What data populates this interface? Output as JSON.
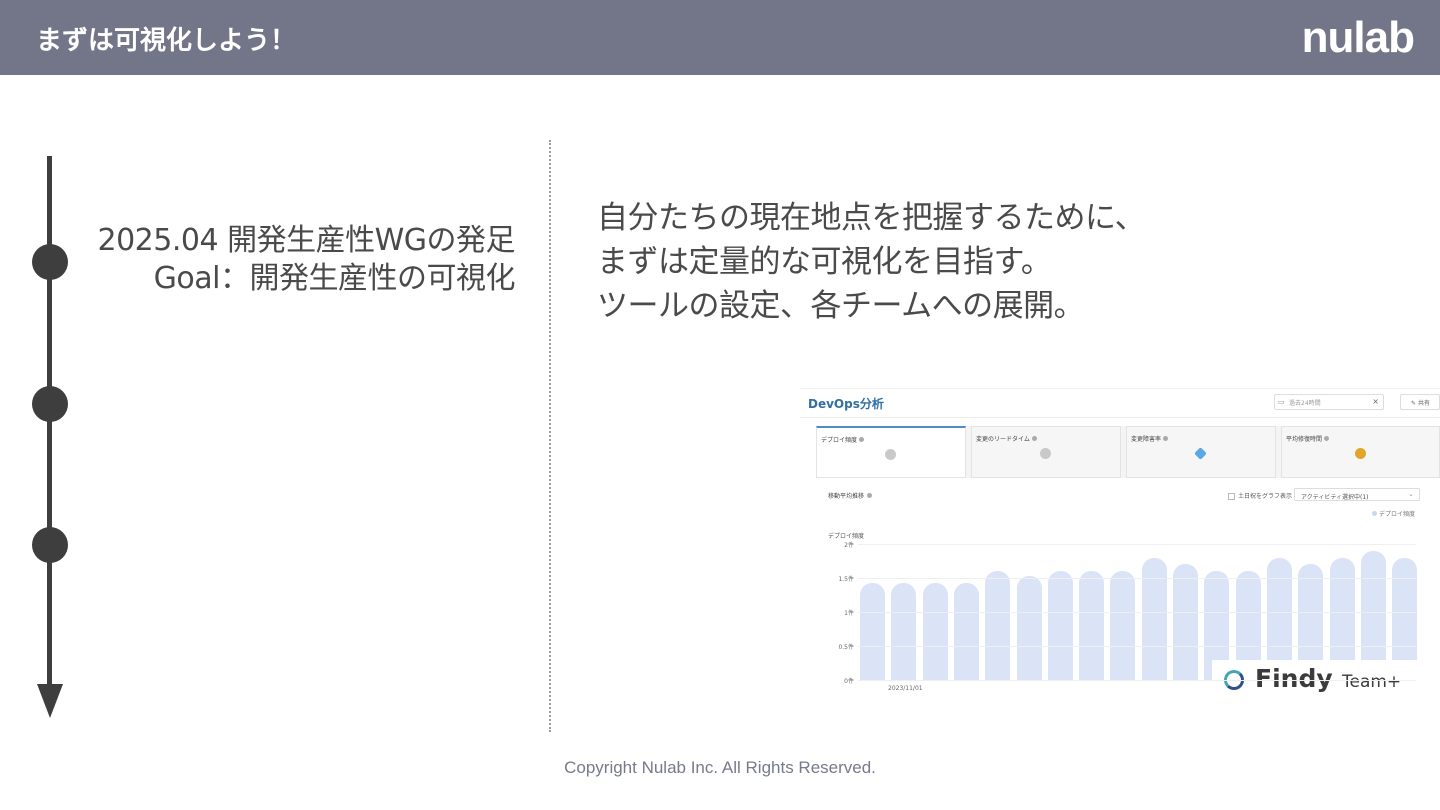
{
  "header": {
    "title": "まずは可視化しよう！",
    "logo": "nulab"
  },
  "milestone": {
    "line1": "2025.04 開発生産性WGの発足",
    "line2": "Goal：開発生産性の可視化"
  },
  "description": {
    "line1": "自分たちの現在地点を把握するために、",
    "line2": "まずは定量的な可視化を目指す。",
    "line3": "ツールの設定、各チームへの展開。"
  },
  "screenshot": {
    "title": "DevOps分析",
    "date_placeholder": "過去24時間",
    "share_label": "共有",
    "kpis": [
      {
        "label": "デプロイ頻度",
        "icon": "smile-icon",
        "color": "#c9c9c9"
      },
      {
        "label": "変更のリードタイム",
        "icon": "smile-icon",
        "color": "#c9c9c9"
      },
      {
        "label": "変更障害率",
        "icon": "diamond-icon",
        "color": "#5aa9e0"
      },
      {
        "label": "平均修復時間",
        "icon": "arrow-icon",
        "color": "#e0a52a"
      }
    ],
    "chart_header": "移動平均推移",
    "weekend_toggle": "土日祝をグラフ表示",
    "activity_select": "アクティビティ選択中(1)",
    "chart_data": {
      "type": "bar",
      "ylabel": "デプロイ頻度",
      "legend": [
        "デプロイ頻度"
      ],
      "yticks": [
        "2件",
        "1.5件",
        "1件",
        "0.5件",
        "0件"
      ],
      "ylim": [
        0,
        2
      ],
      "xticks": [
        "2023/11/01"
      ],
      "values": [
        1.42,
        1.42,
        1.42,
        1.42,
        1.6,
        1.53,
        1.6,
        1.6,
        1.6,
        1.8,
        1.7,
        1.6,
        1.6,
        1.8,
        1.7,
        1.8,
        1.9,
        1.8
      ]
    },
    "brand": {
      "name": "Findy",
      "sub": "Team+"
    }
  },
  "footer": {
    "copyright": "Copyright Nulab Inc. All Rights Reserved."
  }
}
